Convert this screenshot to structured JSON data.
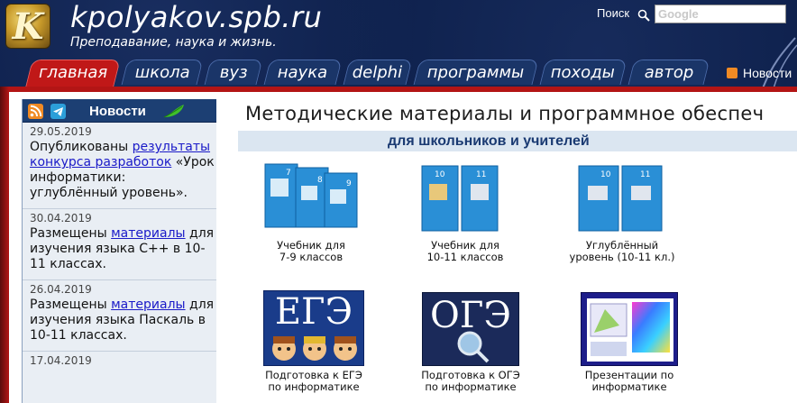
{
  "header": {
    "site_title": "kpolyakov.spb.ru",
    "subtitle": "Преподавание, наука и жизнь.",
    "logo_letter": "K",
    "search": {
      "label": "Поиск",
      "placeholder": "Google"
    }
  },
  "nav": {
    "tabs": [
      {
        "label": "главная",
        "active": true
      },
      {
        "label": "школа",
        "active": false
      },
      {
        "label": "вуз",
        "active": false
      },
      {
        "label": "наука",
        "active": false
      },
      {
        "label": "delphi",
        "active": false
      },
      {
        "label": "программы",
        "active": false
      },
      {
        "label": "походы",
        "active": false
      },
      {
        "label": "автор",
        "active": false
      }
    ],
    "news_link": "Новости"
  },
  "sidebar": {
    "title": "Новости",
    "icons": [
      "rss-icon",
      "telegram-icon",
      "leaf-icon"
    ],
    "items": [
      {
        "date": "29.05.2019",
        "before": "Опубликованы ",
        "link": "результаты конкурса разработок",
        "after": " «Урок информатики: углублённый уровень»."
      },
      {
        "date": "30.04.2019",
        "before": "Размещены ",
        "link": "материалы",
        "after": " для изучения языка С++ в 10-11 классах."
      },
      {
        "date": "26.04.2019",
        "before": "Размещены ",
        "link": "материалы",
        "after": " для изучения языка Паскаль в 10-11 классах."
      },
      {
        "date": "17.04.2019",
        "before": "",
        "link": "",
        "after": ""
      }
    ]
  },
  "main": {
    "title": "Методические материалы и программное обеспеч",
    "section_title": "для школьников и учителей",
    "cards": [
      {
        "caption_lines": [
          "Учебник для",
          "7-9 классов"
        ],
        "book_numbers": [
          "7",
          "8",
          "9"
        ]
      },
      {
        "caption_lines": [
          "Учебник для",
          "10-11 классов"
        ],
        "book_numbers": [
          "10",
          "11"
        ]
      },
      {
        "caption_lines": [
          "Углублённый",
          "уровень (10-11 кл.)"
        ],
        "book_numbers": [
          "10",
          "11"
        ]
      },
      {
        "caption_lines": [
          "Подготовка к ЕГЭ",
          "по информатике"
        ],
        "badge": "ЕГЭ"
      },
      {
        "caption_lines": [
          "Подготовка к ОГЭ",
          "по информатике"
        ],
        "badge": "ОГЭ"
      },
      {
        "caption_lines": [
          "Презентации по",
          "информатике"
        ]
      }
    ]
  },
  "colors": {
    "header_bg": "#0d1f4a",
    "tab_bg": "#1a3568",
    "tab_active": "#c01818",
    "accent_red": "#b31515",
    "sidebar_header": "#1c3f73",
    "section_bar": "#dbe6f1",
    "link": "#1a1ac8",
    "book_blue": "#2a8fd6"
  }
}
